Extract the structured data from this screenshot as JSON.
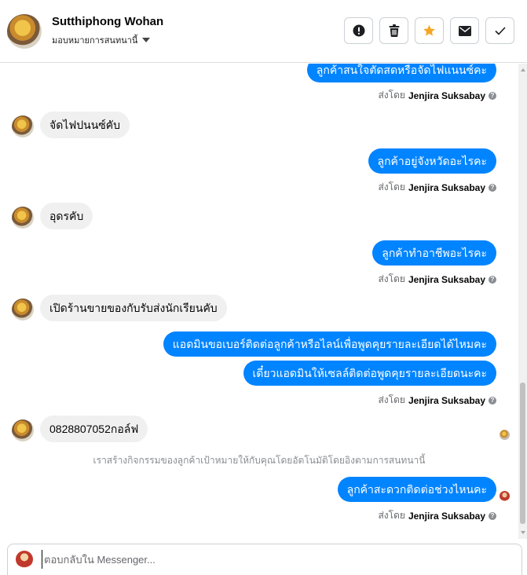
{
  "header": {
    "contact_name": "Sutthiphong Wohan",
    "assign_label": "มอบหมายการสนทนานี้",
    "actions": [
      {
        "name": "mark-spam-button",
        "icon": "alert-circle-icon"
      },
      {
        "name": "delete-button",
        "icon": "trash-icon"
      },
      {
        "name": "star-button",
        "icon": "star-icon",
        "color": "#f5a623"
      },
      {
        "name": "mark-unread-button",
        "icon": "envelope-icon"
      },
      {
        "name": "mark-done-button",
        "icon": "check-icon"
      }
    ]
  },
  "messages": {
    "out_1": "ลูกค้าสนใจตัดสดหรือจัดไฟแนนซ์คะ",
    "in_1": "จัดไฟปนนซ์คับ",
    "out_2": "ลูกค้าอยู่จังหวัดอะไรคะ",
    "in_2": "อุดรคับ",
    "out_3": "ลูกค้าทำอาชีพอะไรคะ",
    "in_3": "เปิดร้านขายของกับรับส่งนักเรียนคับ",
    "out_4a": "แอดมินขอเบอร์ติดต่อลูกค้าหรือไลน์เพื่อพูดคุยรายละเอียดได้ไหมคะ",
    "out_4b": "เดี๋ยวแอดมินให้เซลล์ติดต่อพูดคุยรายละเอียดนะคะ",
    "in_4": "0828807052กอล์ฟ",
    "system_note": "เราสร้างกิจกรรมของลูกค้าเป้าหมายให้กับคุณโดยอัตโนมัติโดยอิงตามการสนทนานี้",
    "out_5": "ลูกค้าสะดวกติดต่อช่วงไหนคะ"
  },
  "sent_by": {
    "prefix": "ส่งโดย",
    "agent": "Jenjira Suksabay"
  },
  "composer": {
    "placeholder": "ตอบกลับใน Messenger..."
  },
  "colors": {
    "outgoing_bubble": "#0084ff",
    "incoming_bubble": "#f0f0f0",
    "star": "#f5a623"
  }
}
